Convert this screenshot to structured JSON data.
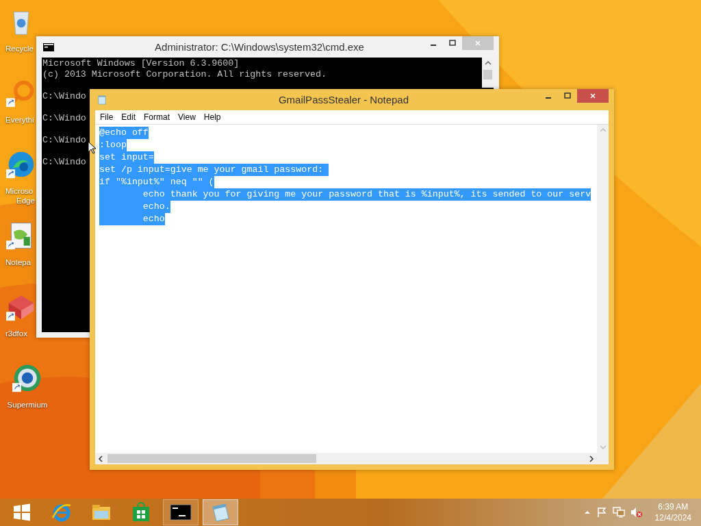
{
  "desktop_icons": [
    {
      "kind": "recycle-bin",
      "shortcut": false,
      "label_lines": [
        "Recycle"
      ]
    },
    {
      "kind": "everything",
      "shortcut": true,
      "label_lines": [
        "Everythi"
      ]
    },
    {
      "kind": "edge",
      "shortcut": true,
      "label_lines": [
        "Microso",
        "Edge"
      ]
    },
    {
      "kind": "notepad-plus",
      "shortcut": true,
      "label_lines": [
        "Notepa"
      ]
    },
    {
      "kind": "r3dfox",
      "shortcut": true,
      "label_lines": [
        "r3dfox"
      ]
    },
    {
      "kind": "supermium",
      "shortcut": true,
      "label_lines": [
        "Supermium"
      ]
    }
  ],
  "cmd_window": {
    "title": "Administrator: C:\\Windows\\system32\\cmd.exe",
    "active": false,
    "header_lines": [
      "Microsoft Windows [Version 6.3.9600]",
      "(c) 2013 Microsoft Corporation. All rights reserved."
    ],
    "prompt_lines": [
      "C:\\Windo",
      "C:\\Windo",
      "C:\\Windo",
      "C:\\Windo"
    ]
  },
  "notepad_window": {
    "title": "GmailPassStealer - Notepad",
    "active": true,
    "menu": [
      "File",
      "Edit",
      "Format",
      "View",
      "Help"
    ],
    "lines": [
      {
        "text": "@echo off",
        "selected": true
      },
      {
        "text": ":loop",
        "selected": true
      },
      {
        "text": "set input=",
        "selected": true
      },
      {
        "text": "set /p input=give me your gmail password: ",
        "selected": true
      },
      {
        "text": "if \"%input%\" neq \"\" (",
        "selected": true
      },
      {
        "text": "        echo thank you for giving me your password that is %input%, its sended to our serv",
        "selected": true
      },
      {
        "text": "        echo.",
        "selected": true
      },
      {
        "text": "        echo",
        "selected": true
      }
    ]
  },
  "taskbar": {
    "apps": [
      {
        "kind": "internet-explorer",
        "selected": false,
        "running": false
      },
      {
        "kind": "file-explorer",
        "selected": false,
        "running": false
      },
      {
        "kind": "store",
        "selected": false,
        "running": false
      },
      {
        "kind": "cmd",
        "selected": false,
        "running": true
      },
      {
        "kind": "notepad",
        "selected": true,
        "running": true
      }
    ],
    "tray": {
      "muted": true,
      "time": "6:39 AM",
      "date": "12/4/2024"
    }
  }
}
